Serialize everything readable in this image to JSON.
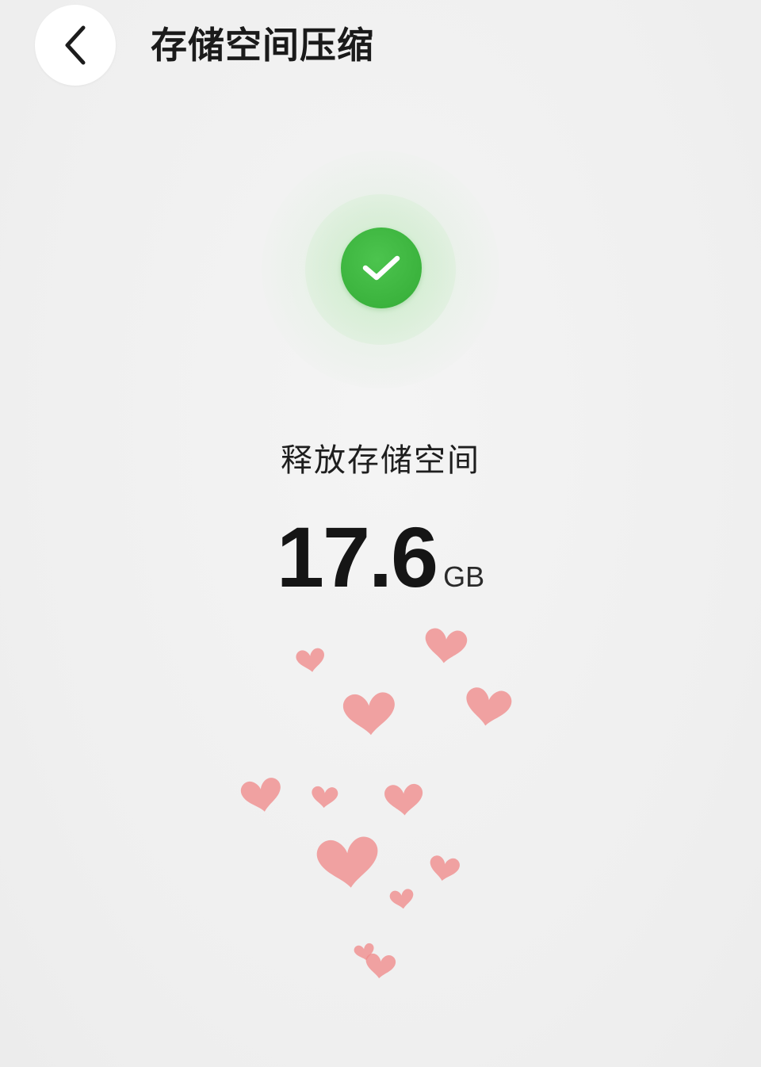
{
  "header": {
    "title": "存储空间压缩",
    "back_icon": "chevron-left-icon"
  },
  "status": {
    "icon": "check-circle-icon",
    "color": "#3cb43e"
  },
  "result": {
    "label": "释放存储空间",
    "value": "17.6",
    "unit": "GB"
  },
  "decoration": {
    "icon": "heart-icon",
    "color": "#f08a8a"
  }
}
